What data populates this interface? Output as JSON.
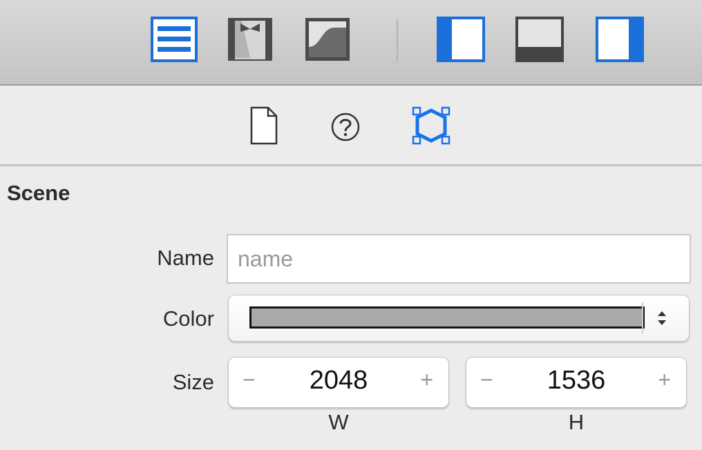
{
  "toolbar": {
    "view_buttons": [
      {
        "name": "standard-editor",
        "icon": "standard-editor-icon",
        "active": true
      },
      {
        "name": "assistant-editor",
        "icon": "assistant-editor-icon",
        "active": false
      },
      {
        "name": "version-editor",
        "icon": "version-editor-icon",
        "active": false
      }
    ],
    "panel_toggles": [
      {
        "name": "navigator",
        "icon": "left-panel-icon",
        "active": true
      },
      {
        "name": "debug-area",
        "icon": "bottom-panel-icon",
        "active": false
      },
      {
        "name": "utilities",
        "icon": "right-panel-icon",
        "active": true
      }
    ]
  },
  "inspector_tabs": [
    {
      "name": "file-inspector",
      "icon": "document-icon",
      "active": false
    },
    {
      "name": "quick-help",
      "icon": "question-mark-icon",
      "active": false
    },
    {
      "name": "node-inspector",
      "icon": "node-hexagon-icon",
      "active": true
    }
  ],
  "scene": {
    "title": "Scene",
    "name_label": "Name",
    "name_value": "",
    "name_placeholder": "name",
    "color_label": "Color",
    "color_value": "#a9a9a9",
    "size_label": "Size",
    "width": "2048",
    "height": "1536",
    "width_label": "W",
    "height_label": "H",
    "minus_symbol": "−",
    "plus_symbol": "+"
  },
  "colors": {
    "accent": "#1a73e8",
    "toolbar_icon": "#555555"
  }
}
